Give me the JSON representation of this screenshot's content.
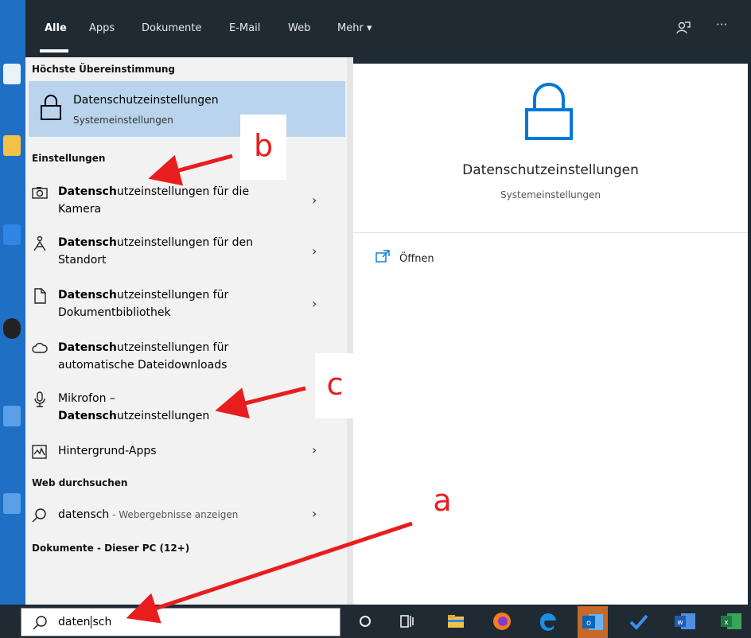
{
  "tabs": [
    "Alle",
    "Apps",
    "Dokumente",
    "E-Mail",
    "Web",
    "Mehr"
  ],
  "best_match": {
    "section": "Höchste Übereinstimmung",
    "title": "Datenschutzeinstellungen",
    "subtitle": "Systemeinstellungen"
  },
  "settings": {
    "section": "Einstellungen",
    "items": [
      {
        "bold": "Datensch",
        "rest": "utzeinstellungen für die",
        "line2": "Kamera",
        "icon": "camera-icon"
      },
      {
        "bold": "Datensch",
        "rest": "utzeinstellungen für den",
        "line2": "Standort",
        "icon": "location-person-icon"
      },
      {
        "bold": "Datensch",
        "rest": "utzeinstellungen für",
        "line2": "Dokumentbibliothek",
        "icon": "document-icon"
      },
      {
        "bold": "Datensch",
        "rest": "utzeinstellungen für",
        "line2": "automatische Dateidownloads",
        "icon": "cloud-icon"
      },
      {
        "line1": "Mikrofon –",
        "bold2": "Datensch",
        "rest2": "utzeinstellungen",
        "icon": "microphone-icon"
      },
      {
        "line1": "Hintergrund-Apps",
        "icon": "background-apps-icon"
      }
    ]
  },
  "web": {
    "section": "Web durchsuchen",
    "query": "datensch",
    "hint": " - Webergebnisse anzeigen"
  },
  "documents": {
    "section": "Dokumente - Dieser PC (12+)"
  },
  "preview": {
    "title": "Datenschutzeinstellungen",
    "subtitle": "Systemeinstellungen",
    "open_label": "Öffnen"
  },
  "search_box": {
    "value_before_cursor": "daten",
    "value_after_cursor": "sch"
  },
  "callouts": [
    "a",
    "b",
    "c"
  ],
  "colors": {
    "accent": "#0078d7",
    "highlight": "#b9d4ec",
    "annotation": "#e81e1e"
  }
}
